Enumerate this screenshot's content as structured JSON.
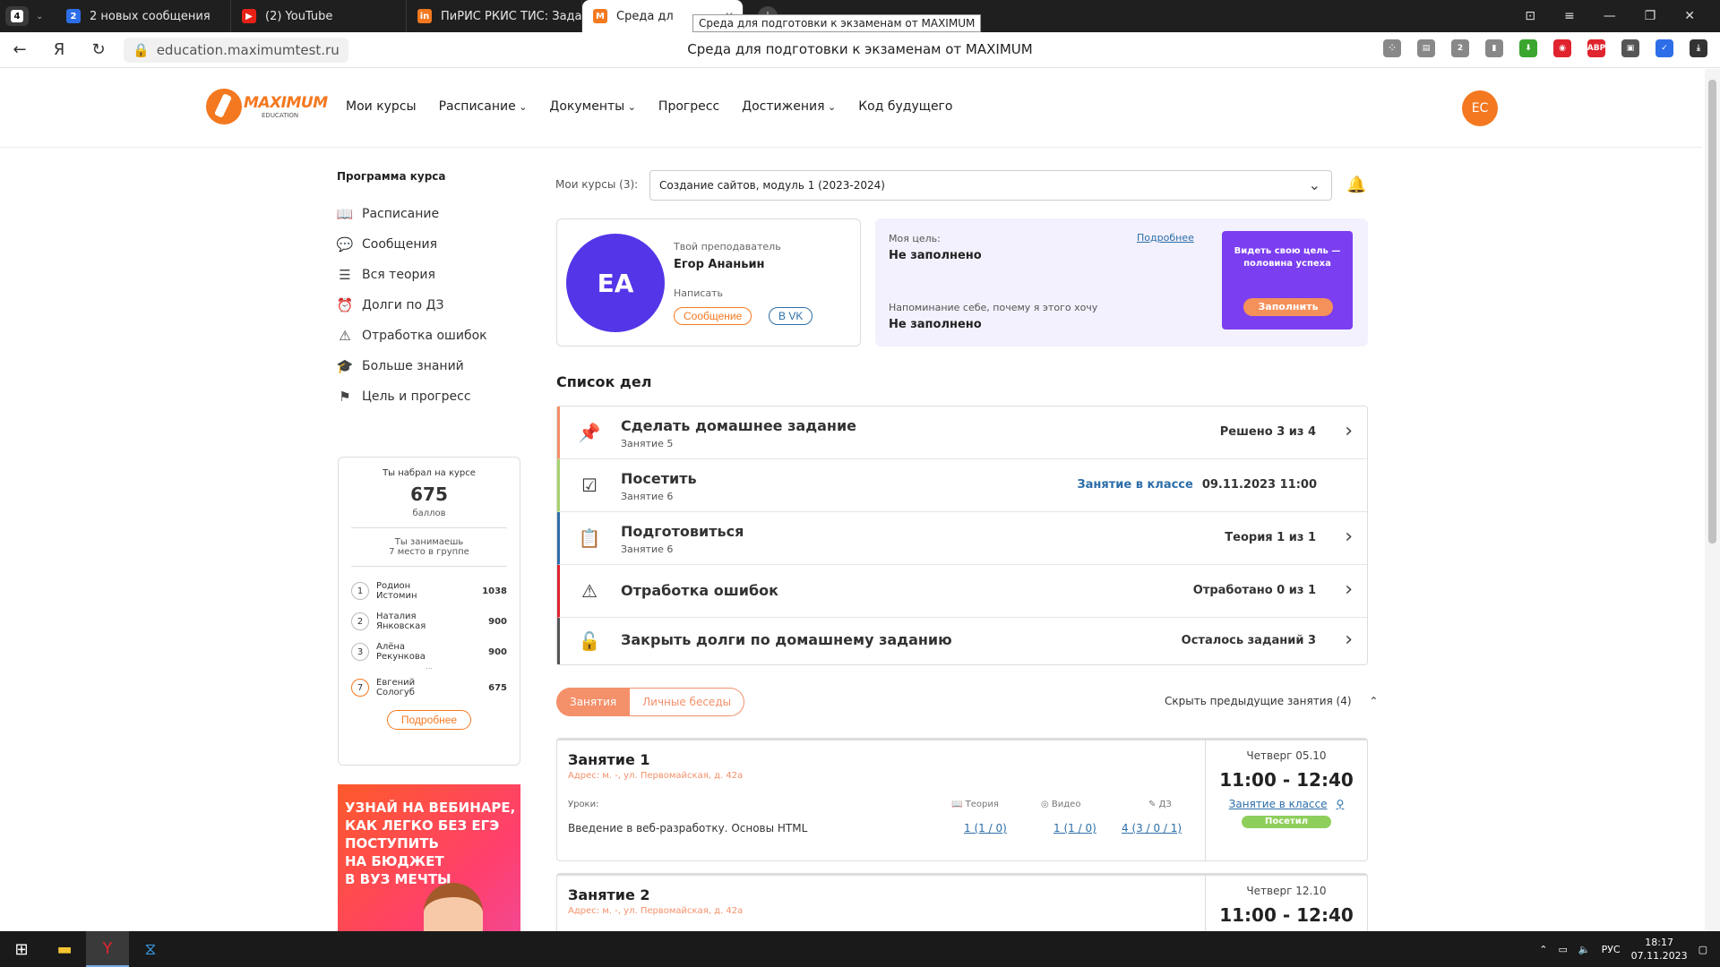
{
  "browser": {
    "tab_count": "4",
    "tabs": [
      {
        "label": "2 новых сообщения",
        "icon_text": "2",
        "color": "#2d6ee8"
      },
      {
        "label": "(2) YouTube",
        "icon_text": "▶",
        "color": "#e62117"
      },
      {
        "label": "ПиРИС РКИС ТИС: Задан",
        "icon_text": "in",
        "color": "#f4781f"
      },
      {
        "label": "Среда дл",
        "icon_text": "M",
        "color": "#f4781f"
      }
    ],
    "tooltip": "Среда для подготовки к экзаменам от MAXIMUM",
    "url": "education.maximumtest.ru",
    "page_title": "Среда для подготовки к экзаменам от MAXIMUM",
    "window_controls": [
      "⊡",
      "≡",
      "—",
      "❐",
      "✕"
    ],
    "extensions": [
      {
        "text": "⁘",
        "color": "#888888"
      },
      {
        "text": "▤",
        "color": "#888888"
      },
      {
        "text": "2",
        "color": "#888888"
      },
      {
        "text": "▮",
        "color": "#888888"
      },
      {
        "text": "⬇",
        "color": "#3aa62e"
      },
      {
        "text": "◉",
        "color": "#e0232e"
      },
      {
        "text": "ABP",
        "color": "#e0232e"
      },
      {
        "text": "▣",
        "color": "#555555"
      },
      {
        "text": "✓",
        "color": "#2d6ee8"
      },
      {
        "text": "⤓",
        "color": "#333333"
      }
    ]
  },
  "header": {
    "logo_main": "MAXIMUM",
    "logo_sub": "EDUCATION",
    "nav": [
      {
        "label": "Мои курсы",
        "dropdown": false
      },
      {
        "label": "Расписание",
        "dropdown": true
      },
      {
        "label": "Документы",
        "dropdown": true
      },
      {
        "label": "Прогресс",
        "dropdown": false
      },
      {
        "label": "Достижения",
        "dropdown": true
      },
      {
        "label": "Код будущего",
        "dropdown": false
      }
    ],
    "user_initials": "ЕС",
    "brand_color": "#f4781f"
  },
  "sidebar": {
    "title": "Программа курса",
    "items": [
      {
        "label": "Расписание",
        "icon": "book-icon",
        "glyph": "📖"
      },
      {
        "label": "Сообщения",
        "icon": "chat-icon",
        "glyph": "💬"
      },
      {
        "label": "Вся теория",
        "icon": "list-icon",
        "glyph": "☰"
      },
      {
        "label": "Долги по ДЗ",
        "icon": "alarm-icon",
        "glyph": "⏰"
      },
      {
        "label": "Отработка ошибок",
        "icon": "warning-icon",
        "glyph": "⚠"
      },
      {
        "label": "Больше знаний",
        "icon": "graduation-icon",
        "glyph": "🎓"
      },
      {
        "label": "Цель и прогресс",
        "icon": "flag-icon",
        "glyph": "⚑"
      }
    ],
    "score": {
      "label_top": "Ты набрал на курсе",
      "points": "675",
      "points_unit": "баллов",
      "place_line1": "Ты занимаешь",
      "place_line2": "7 место в группе",
      "ranking": [
        {
          "place": "1",
          "first": "Родион",
          "last": "Истомин",
          "points": "1038",
          "me": false
        },
        {
          "place": "2",
          "first": "Наталия",
          "last": "Янковская",
          "points": "900",
          "me": false
        },
        {
          "place": "3",
          "first": "Алёна",
          "last": "Рекункова",
          "points": "900",
          "me": false
        },
        {
          "place": "7",
          "first": "Евгений",
          "last": "Сологуб",
          "points": "675",
          "me": true
        }
      ],
      "more_button": "Подробнее"
    },
    "promo": {
      "line1": "Узнай на вебинаре,",
      "line2": "как легко без ЕГЭ",
      "line3": "поступить",
      "line4": "на бюджет",
      "line5": "в вуз мечты"
    }
  },
  "main": {
    "courses_label": "Мои курсы (3):",
    "course_selected": "Создание сайтов, модуль 1 (2023-2024)",
    "teacher": {
      "initials": "ЕА",
      "label": "Твой преподаватель",
      "name": "Егор Ананьин",
      "write_label": "Написать",
      "btn_message": "Сообщение",
      "btn_vk": "В VK"
    },
    "goal": {
      "goal_label": "Моя цель:",
      "goal_value": "Не заполнено",
      "reminder_label": "Напоминание себе, почему я этого хочу",
      "reminder_value": "Не заполнено",
      "details_link": "Подробнее",
      "promo_text": "Видеть свою цель — половина успеха",
      "fill_button": "Заполнить"
    },
    "todo_title": "Список дел",
    "todos": [
      {
        "title": "Сделать домашнее задание",
        "sub": "Занятие 5",
        "status": "Решено 3 из 4",
        "extra": "",
        "icon": "pin-icon",
        "glyph": "📌",
        "color": "#f4906a",
        "arrow": true
      },
      {
        "title": "Посетить",
        "sub": "Занятие 6",
        "status": "09.11.2023 11:00",
        "extra": "Занятие в классе",
        "icon": "checkbox-icon",
        "glyph": "☑",
        "color": "#a6d16e",
        "arrow": false
      },
      {
        "title": "Подготовиться",
        "sub": "Занятие 6",
        "status": "Теория 1 из 1",
        "extra": "",
        "icon": "clipboard-icon",
        "glyph": "📋",
        "color": "#2d6ea8",
        "arrow": true
      },
      {
        "title": "Отработка ошибок",
        "sub": "",
        "status": "Отработано 0 из 1",
        "extra": "",
        "icon": "warning-icon",
        "glyph": "⚠",
        "color": "#e0232e",
        "arrow": true
      },
      {
        "title": "Закрыть долги по домашнему заданию",
        "sub": "",
        "status": "Осталось заданий 3",
        "extra": "",
        "icon": "unlock-icon",
        "glyph": "🔓",
        "color": "#555555",
        "arrow": true
      }
    ],
    "segments": {
      "active": "Занятия",
      "inactive": "Личные беседы"
    },
    "hide_prev": "Скрыть предыдущие занятия (4)",
    "lessons": [
      {
        "name": "Занятие 1",
        "address": "Адрес: м. -, ул. Первомайская, д. 42а",
        "lessons_label": "Уроки:",
        "topic": "Введение в веб-разработку. Основы HTML",
        "col_theory": "Теория",
        "col_video": "Видео",
        "col_hw": "ДЗ",
        "theory": "1 (1 / 0)",
        "video": "1 (1 / 0)",
        "hw": "4 (3 / 0 / 1)",
        "day": "Четверг 05.10",
        "time": "11:00 - 12:40",
        "class_link": "Занятие в классе",
        "status": "Посетил"
      },
      {
        "name": "Занятие 2",
        "address": "Адрес: м. -, ул. Первомайская, д. 42а",
        "day": "Четверг 12.10",
        "time": "11:00 - 12:40"
      }
    ]
  },
  "taskbar": {
    "lang": "РУС",
    "time": "18:17",
    "date": "07.11.2023"
  }
}
